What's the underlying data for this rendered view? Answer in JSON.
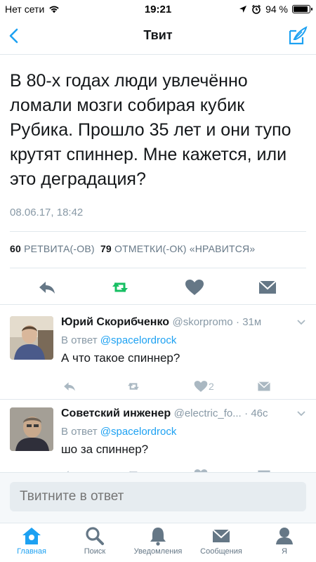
{
  "status_bar": {
    "carrier": "Нет сети",
    "time": "19:21",
    "battery_text": "94 %",
    "battery_level": 0.94,
    "icons": [
      "wifi-icon",
      "location-arrow-icon",
      "alarm-icon",
      "battery-icon"
    ]
  },
  "nav": {
    "title": "Твит",
    "back_icon": "chevron-left-icon",
    "compose_icon": "compose-tweet-icon"
  },
  "tweet": {
    "text": "В 80-х годах люди увлечённо ломали мозги собирая кубик Рубика. Прошло 35 лет и они тупо крутят спиннер. Мне кажется, или это деградация?",
    "date": "08.06.17, 18:42",
    "retweets_count": "60",
    "retweets_label": "РЕТВИТА(-ОВ)",
    "likes_count": "79",
    "likes_label": "ОТМЕТКИ(-ОК) «НРАВИТСЯ»",
    "actions": [
      "reply-icon",
      "retweet-icon",
      "heart-icon",
      "direct-message-icon"
    ],
    "retweet_active_color": "#17bf63"
  },
  "replies": [
    {
      "name": "Юрий Скорибченко",
      "handle": "@skorpromo",
      "time": "· 31м",
      "in_reply_prefix": "В ответ",
      "in_reply_to": "@spacelordrock",
      "text": "А что такое спиннер?",
      "like_count": "2"
    },
    {
      "name": "Советский инженер",
      "handle": "@electric_fo...",
      "time": "· 46с",
      "in_reply_prefix": "В ответ",
      "in_reply_to": "@spacelordrock",
      "text": "шо за спиннер?",
      "like_count": ""
    }
  ],
  "reply_bar": {
    "placeholder": "Твитните в ответ"
  },
  "tabs": [
    {
      "label": "Главная",
      "icon": "home-icon",
      "active": true
    },
    {
      "label": "Поиск",
      "icon": "search-icon",
      "active": false
    },
    {
      "label": "Уведомления",
      "icon": "bell-icon",
      "active": false
    },
    {
      "label": "Сообщения",
      "icon": "envelope-icon",
      "active": false
    },
    {
      "label": "Я",
      "icon": "person-icon",
      "active": false
    }
  ],
  "colors": {
    "accent": "#1da1f2",
    "secondary_text": "#8899a6",
    "retweet_green": "#17bf63"
  }
}
